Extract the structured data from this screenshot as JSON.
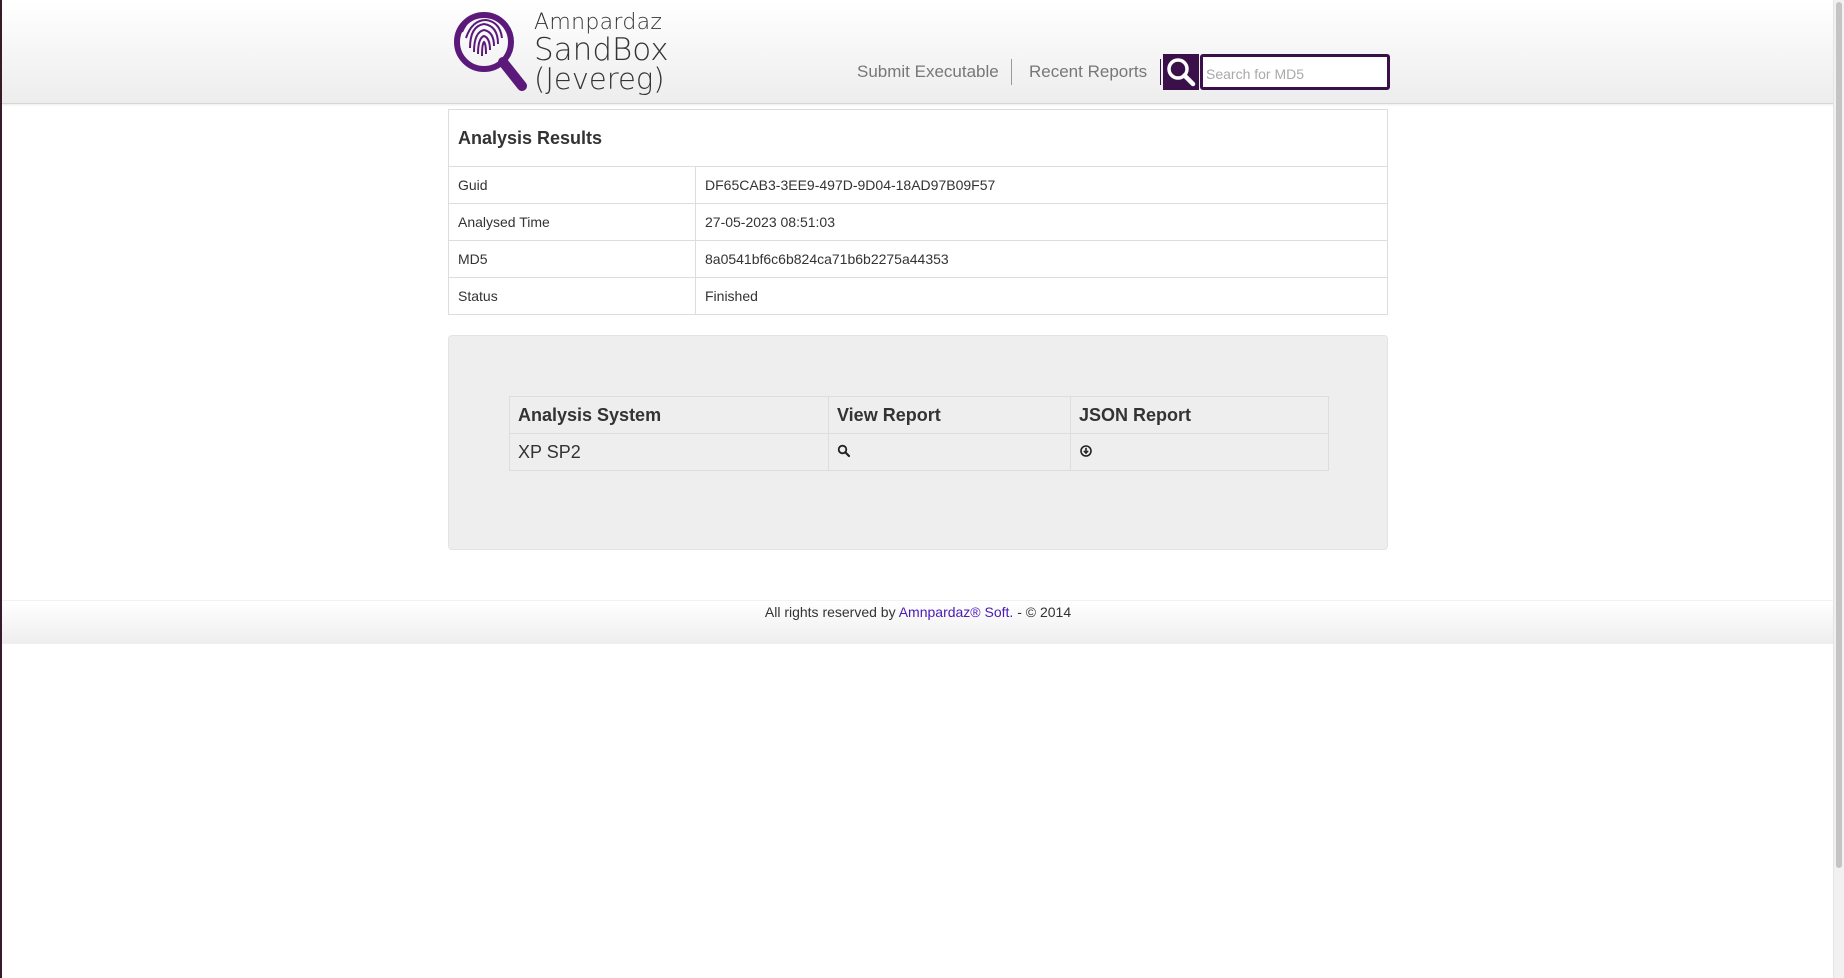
{
  "brand": {
    "line1": "Amnpardaz",
    "line2": "SandBox",
    "line3": "(Jevereg)",
    "accent_color": "#3a0f4a"
  },
  "nav": {
    "submit": "Submit Executable",
    "recent": "Recent Reports",
    "search_placeholder": "Search for MD5",
    "search_value": "",
    "search_icon": "search-icon"
  },
  "results": {
    "title": "Analysis Results",
    "rows": [
      {
        "label": "Guid",
        "value": "DF65CAB3-3EE9-497D-9D04-18AD97B09F57"
      },
      {
        "label": "Analysed Time",
        "value": "27-05-2023 08:51:03"
      },
      {
        "label": "MD5",
        "value": "8a0541bf6c6b824ca71b6b2275a44353"
      },
      {
        "label": "Status",
        "value": "Finished"
      }
    ]
  },
  "systems": {
    "headers": [
      "Analysis System",
      "View Report",
      "JSON Report"
    ],
    "rows": [
      {
        "system": "XP SP2",
        "view_icon": "search-icon",
        "json_icon": "download-icon"
      }
    ]
  },
  "footer": {
    "prefix": "All rights reserved by",
    "link": "Amnpardaz® Soft.",
    "suffix": "- © 2014",
    "link_color": "#4b19b5"
  }
}
